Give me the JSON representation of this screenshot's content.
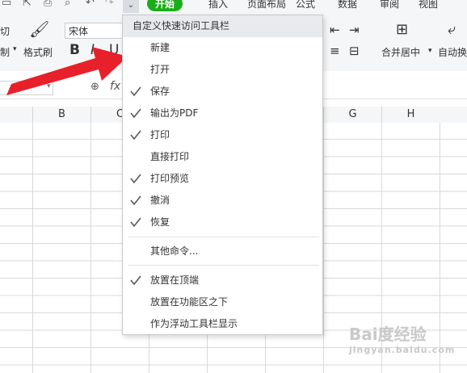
{
  "menu": {
    "tabs": [
      "开始",
      "插入",
      "页面布局",
      "公式",
      "数据",
      "审阅",
      "视图"
    ],
    "active_tab": "开始"
  },
  "ribbon": {
    "cut_label": "切",
    "copy_label": "制",
    "format_painter_label": "格式刷",
    "font_name": "宋体",
    "bold": "B",
    "italic": "I",
    "underline": "U",
    "merge_label": "合并居中",
    "wrap_label": "自动换"
  },
  "formula_bar": {
    "fx_label": "fx"
  },
  "grid": {
    "columns": [
      "B",
      "C",
      "G",
      "H"
    ]
  },
  "dropdown": {
    "title": "自定义快速访问工具栏",
    "items": [
      {
        "label": "新建",
        "checked": false
      },
      {
        "label": "打开",
        "checked": false
      },
      {
        "label": "保存",
        "checked": true
      },
      {
        "label": "输出为PDF",
        "checked": true
      },
      {
        "label": "打印",
        "checked": true
      },
      {
        "label": "直接打印",
        "checked": false
      },
      {
        "label": "打印预览",
        "checked": true
      },
      {
        "label": "撤消",
        "checked": true
      },
      {
        "label": "恢复",
        "checked": true
      }
    ],
    "more_commands": "其他命令...",
    "position_options": [
      {
        "label": "放置在顶端",
        "checked": true
      },
      {
        "label": "放置在功能区之下",
        "checked": false
      },
      {
        "label": "作为浮动工具栏显示",
        "checked": false
      }
    ]
  },
  "watermark": {
    "main": "Bai度经验",
    "sub": "jingyan.baidu.com"
  },
  "colors": {
    "active_tab": "#1aad19",
    "arrow": "#e8202a",
    "header_bg": "#e8eaed"
  }
}
